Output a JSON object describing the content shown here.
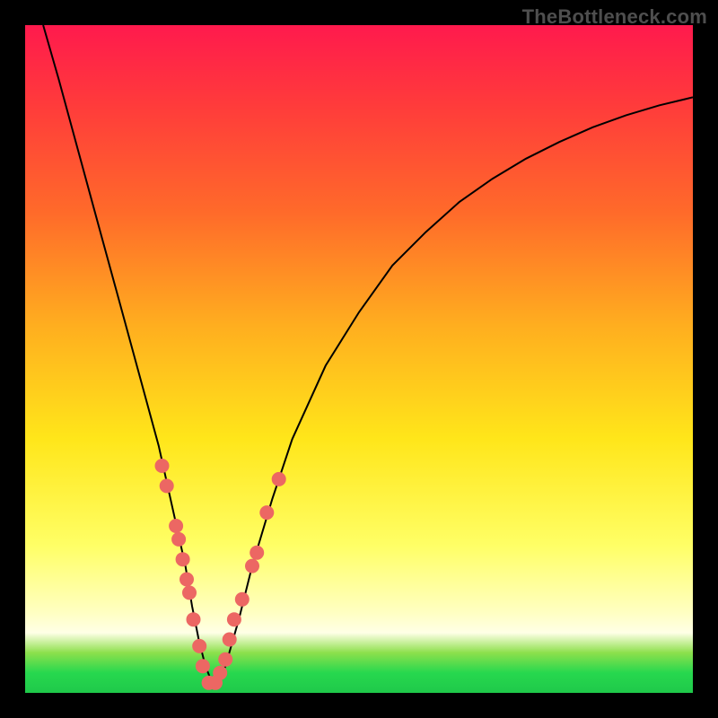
{
  "brand": "TheBottleneck.com",
  "colors": {
    "background": "#000000",
    "gradient_top": "#ff1a4d",
    "gradient_mid": "#ffe61a",
    "gradient_bottom": "#1fc94a",
    "curve": "#000000",
    "dots": "#ec6763"
  },
  "chart_data": {
    "type": "line",
    "title": "",
    "xlabel": "",
    "ylabel": "",
    "xlim": [
      0,
      100
    ],
    "ylim": [
      0,
      100
    ],
    "series": [
      {
        "name": "bottleneck-curve",
        "x": [
          2.7,
          5,
          8,
          11,
          14,
          17,
          20,
          22,
          24,
          25,
          26,
          27,
          28,
          29,
          30,
          32,
          34,
          37,
          40,
          45,
          50,
          55,
          60,
          65,
          70,
          75,
          80,
          85,
          90,
          95,
          100
        ],
        "y": [
          100,
          92,
          81,
          70,
          59,
          48,
          37,
          28,
          19,
          13,
          8,
          4,
          1.5,
          1.5,
          4,
          11,
          19,
          29,
          38,
          49,
          57,
          64,
          69,
          73.5,
          77,
          80,
          82.5,
          84.7,
          86.5,
          88,
          89.2
        ]
      }
    ],
    "markers": [
      {
        "x": 20.5,
        "y": 34
      },
      {
        "x": 21.2,
        "y": 31
      },
      {
        "x": 22.6,
        "y": 25
      },
      {
        "x": 23.0,
        "y": 23
      },
      {
        "x": 23.6,
        "y": 20
      },
      {
        "x": 24.2,
        "y": 17
      },
      {
        "x": 24.6,
        "y": 15
      },
      {
        "x": 25.2,
        "y": 11
      },
      {
        "x": 26.1,
        "y": 7
      },
      {
        "x": 26.6,
        "y": 4
      },
      {
        "x": 27.5,
        "y": 1.5
      },
      {
        "x": 28.5,
        "y": 1.5
      },
      {
        "x": 29.2,
        "y": 3
      },
      {
        "x": 30.0,
        "y": 5
      },
      {
        "x": 30.6,
        "y": 8
      },
      {
        "x": 31.3,
        "y": 11
      },
      {
        "x": 32.5,
        "y": 14
      },
      {
        "x": 34.0,
        "y": 19
      },
      {
        "x": 34.7,
        "y": 21
      },
      {
        "x": 36.2,
        "y": 27
      },
      {
        "x": 38.0,
        "y": 32
      }
    ],
    "marker_radius": 8
  }
}
